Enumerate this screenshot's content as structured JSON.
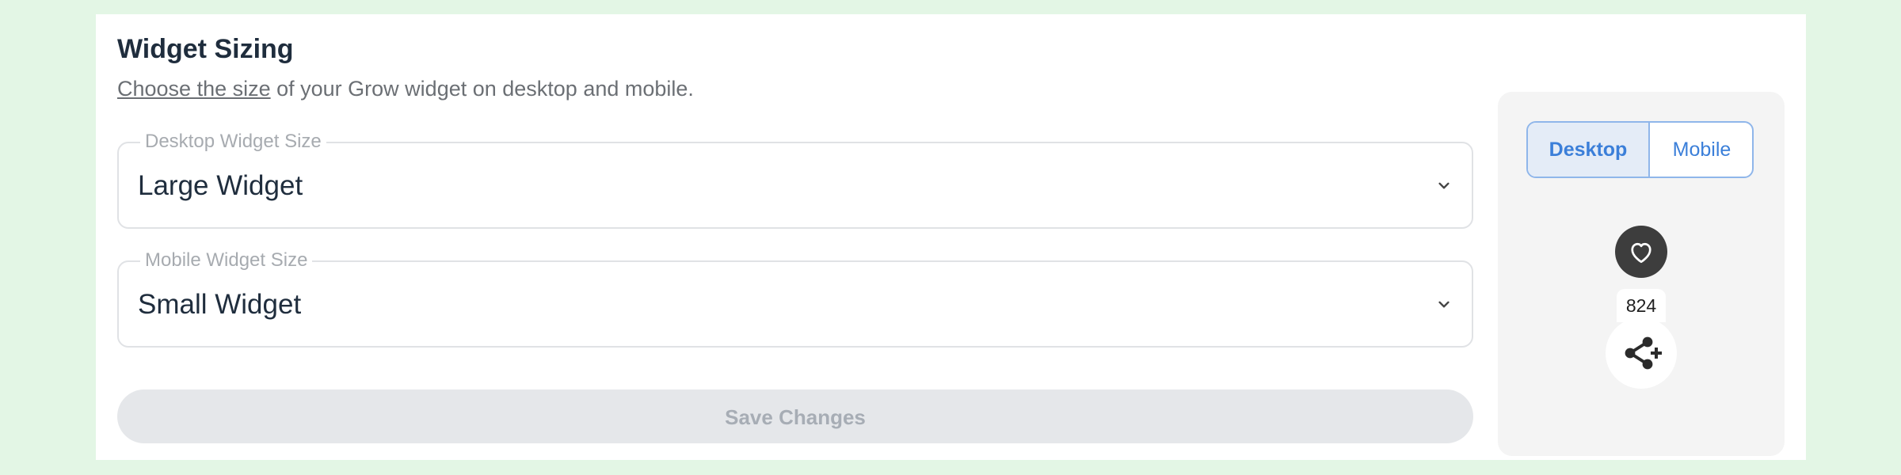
{
  "section": {
    "title": "Widget Sizing",
    "subtitle_link": "Choose the size",
    "subtitle_rest": " of your Grow widget on desktop and mobile."
  },
  "desktop_size": {
    "label": "Desktop Widget Size",
    "value": "Large Widget",
    "icon": "chevron-down-icon"
  },
  "mobile_size": {
    "label": "Mobile Widget Size",
    "value": "Small Widget",
    "icon": "chevron-down-icon"
  },
  "save_button": {
    "label": "Save Changes"
  },
  "preview": {
    "toggle": {
      "desktop_label": "Desktop",
      "mobile_label": "Mobile",
      "selected": "Desktop"
    },
    "like_icon": "heart-icon",
    "like_count": "824",
    "share_icon": "share-plus-icon"
  },
  "colors": {
    "page_background": "#e3f6e5",
    "accent": "#3b7fd9",
    "disabled_button": "#e5e7ea"
  }
}
